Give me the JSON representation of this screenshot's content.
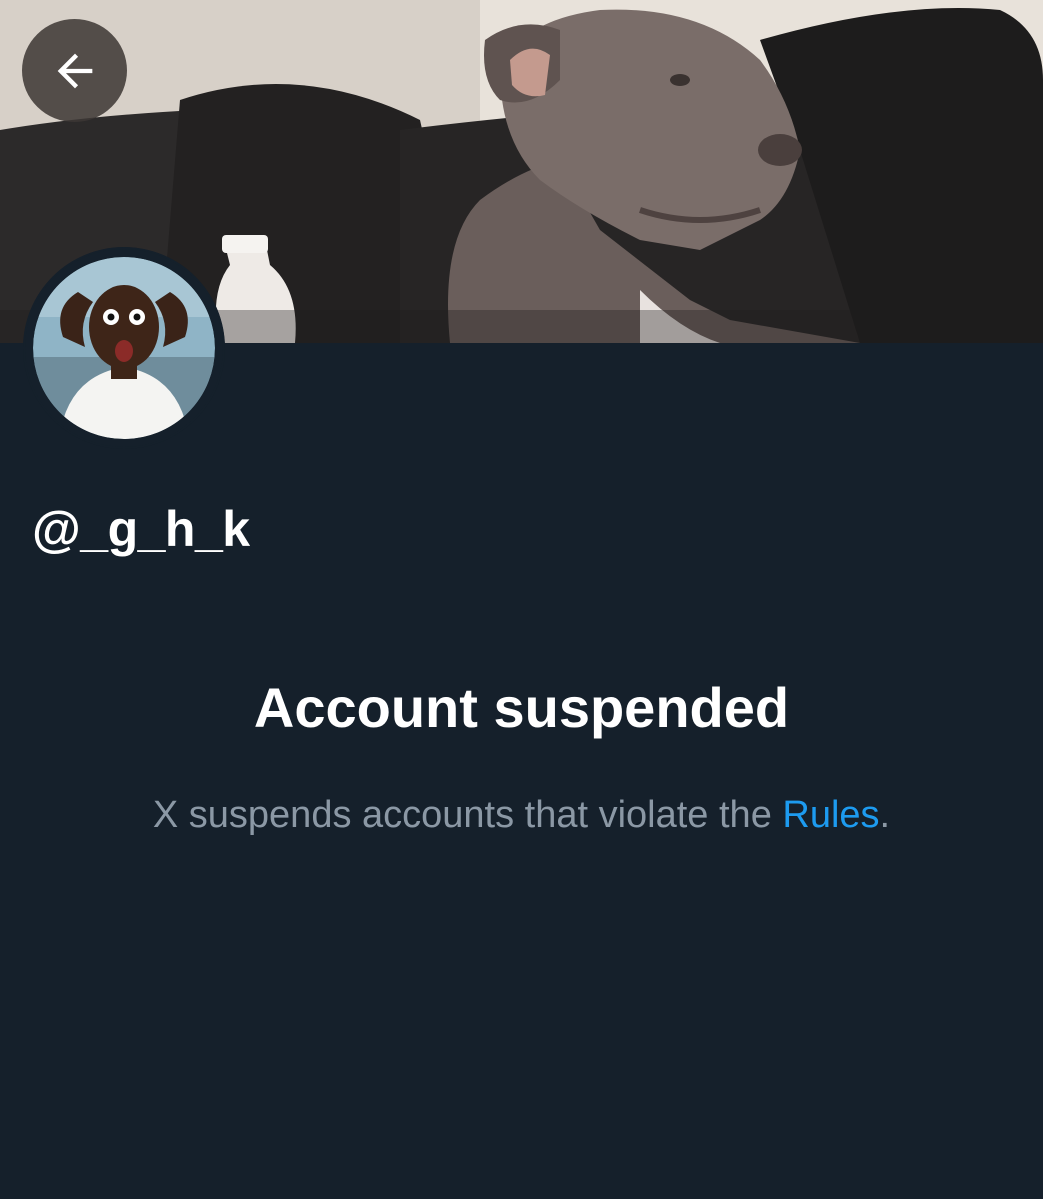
{
  "header": {
    "back_icon": "arrow-left-icon",
    "banner_image": "dog-on-couch-photo"
  },
  "profile": {
    "avatar_image": "surprised-man-photo",
    "handle": "@_g_h_k"
  },
  "suspension": {
    "title": "Account suspended",
    "message_prefix": "X suspends accounts that violate the ",
    "rules_link": "Rules",
    "message_suffix": "."
  },
  "colors": {
    "background": "#15202b",
    "primary_text": "#ffffff",
    "secondary_text": "#8b98a5",
    "link": "#1d9bf0"
  }
}
